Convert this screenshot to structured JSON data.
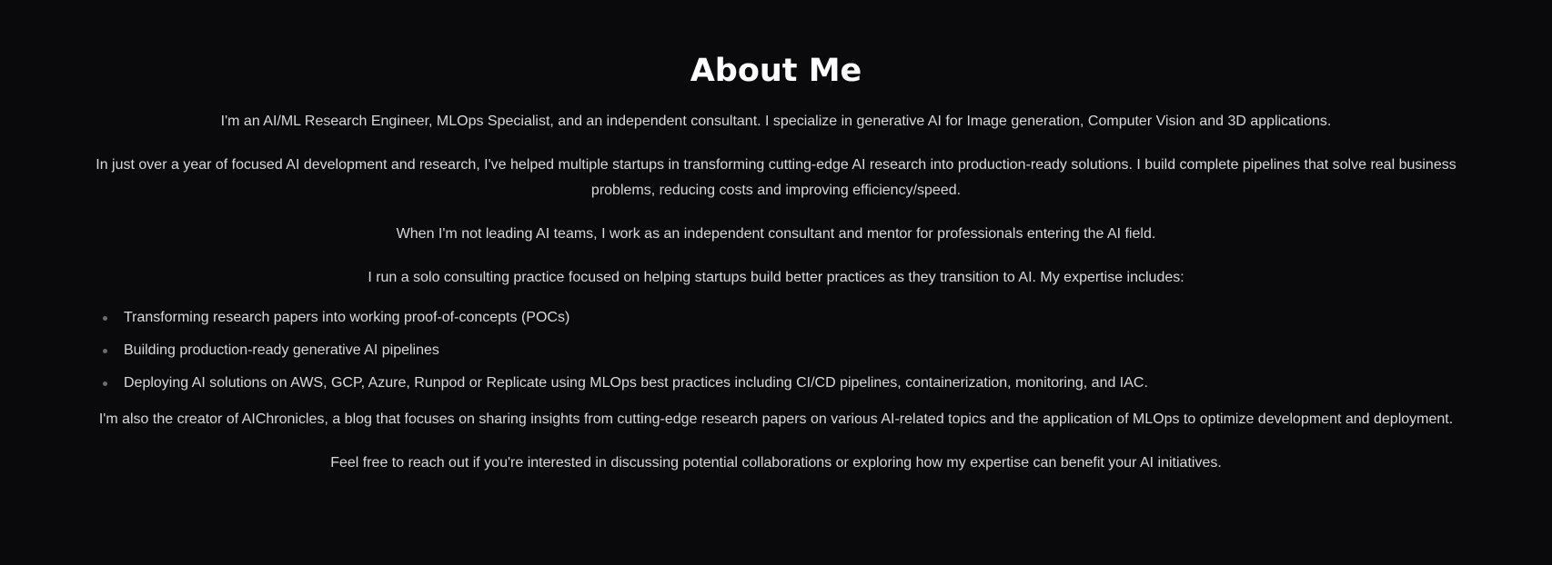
{
  "about": {
    "title": "About Me",
    "paragraphs": [
      "I'm an AI/ML Research Engineer, MLOps Specialist, and an independent consultant. I specialize in generative AI for Image generation, Computer Vision and 3D applications.",
      "In just over a year of focused AI development and research, I've helped multiple startups in transforming cutting-edge AI research into production-ready solutions. I build complete pipelines that solve real business problems, reducing costs and improving efficiency/speed.",
      "When I'm not leading AI teams, I work as an independent consultant and mentor for professionals entering the AI field.",
      "I run a solo consulting practice focused on helping startups build better practices as they transition to AI. My expertise includes:"
    ],
    "expertise": [
      "Transforming research papers into working proof-of-concepts (POCs)",
      "Building production-ready generative AI pipelines",
      "Deploying AI solutions on AWS, GCP, Azure, Runpod or Replicate using MLOps best practices including CI/CD pipelines, containerization, monitoring, and IAC."
    ],
    "closing": [
      "I'm also the creator of AIChronicles, a blog that focuses on sharing insights from cutting-edge research papers on various AI-related topics and the application of MLOps to optimize development and deployment.",
      "Feel free to reach out if you're interested in discussing potential collaborations or exploring how my expertise can benefit your AI initiatives."
    ]
  },
  "colors": {
    "background": "#0a0a0c",
    "heading": "#ffffff",
    "text": "#d8d8d8",
    "bullet": "#6b6b6b"
  }
}
